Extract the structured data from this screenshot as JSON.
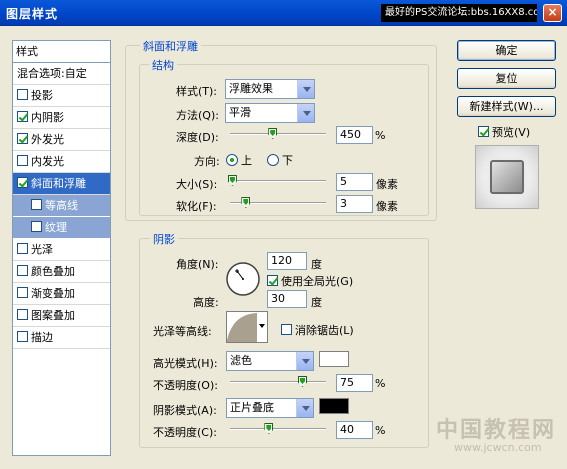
{
  "window": {
    "title": "图层样式",
    "banner": "最好的PS交流论坛:bbs.16XX8.com",
    "close_label": "×"
  },
  "style_list": {
    "header": "样式",
    "blend_options": "混合选项:自定",
    "items": [
      {
        "label": "投影",
        "checked": false
      },
      {
        "label": "内阴影",
        "checked": true
      },
      {
        "label": "外发光",
        "checked": true
      },
      {
        "label": "内发光",
        "checked": false
      },
      {
        "label": "斜面和浮雕",
        "checked": true,
        "selected": true
      },
      {
        "label": "等高线",
        "checked": false,
        "sub": true
      },
      {
        "label": "纹理",
        "checked": false,
        "sub": true
      },
      {
        "label": "光泽",
        "checked": false
      },
      {
        "label": "颜色叠加",
        "checked": false
      },
      {
        "label": "渐变叠加",
        "checked": false
      },
      {
        "label": "图案叠加",
        "checked": false
      },
      {
        "label": "描边",
        "checked": false
      }
    ]
  },
  "bevel": {
    "group_title": "斜面和浮雕",
    "structure_title": "结构",
    "style_label": "样式(T):",
    "style_value": "浮雕效果",
    "technique_label": "方法(Q):",
    "technique_value": "平滑",
    "depth_label": "深度(D):",
    "depth_value": "450",
    "depth_slider": 0.44,
    "percent": "%",
    "direction_label": "方向:",
    "direction_up": "上",
    "direction_down": "下",
    "size_label": "大小(S):",
    "size_value": "5",
    "size_slider": 0.02,
    "pixels": "像素",
    "soften_label": "软化(F):",
    "soften_value": "3",
    "soften_slider": 0.16
  },
  "shading": {
    "group_title": "阴影",
    "angle_label": "角度(N):",
    "angle_value": "120",
    "degree": "度",
    "global_light_label": "使用全局光(G)",
    "altitude_label": "高度:",
    "altitude_value": "30",
    "gloss_contour_label": "光泽等高线:",
    "anti_alias_label": "消除锯齿(L)",
    "highlight_mode_label": "高光模式(H):",
    "highlight_mode_value": "滤色",
    "highlight_color": "#ffffff",
    "highlight_opacity_label": "不透明度(O):",
    "highlight_opacity_value": "75",
    "highlight_opacity_slider": 0.75,
    "shadow_mode_label": "阴影模式(A):",
    "shadow_mode_value": "正片叠底",
    "shadow_color": "#000000",
    "shadow_opacity_label": "不透明度(C):",
    "shadow_opacity_value": "40",
    "shadow_opacity_slider": 0.4,
    "percent": "%"
  },
  "buttons": {
    "ok": "确定",
    "reset": "复位",
    "new_style": "新建样式(W)...",
    "preview_label": "预览(V)"
  },
  "watermark": {
    "text": "中国教程网",
    "url": "www.jcwcn.com"
  }
}
